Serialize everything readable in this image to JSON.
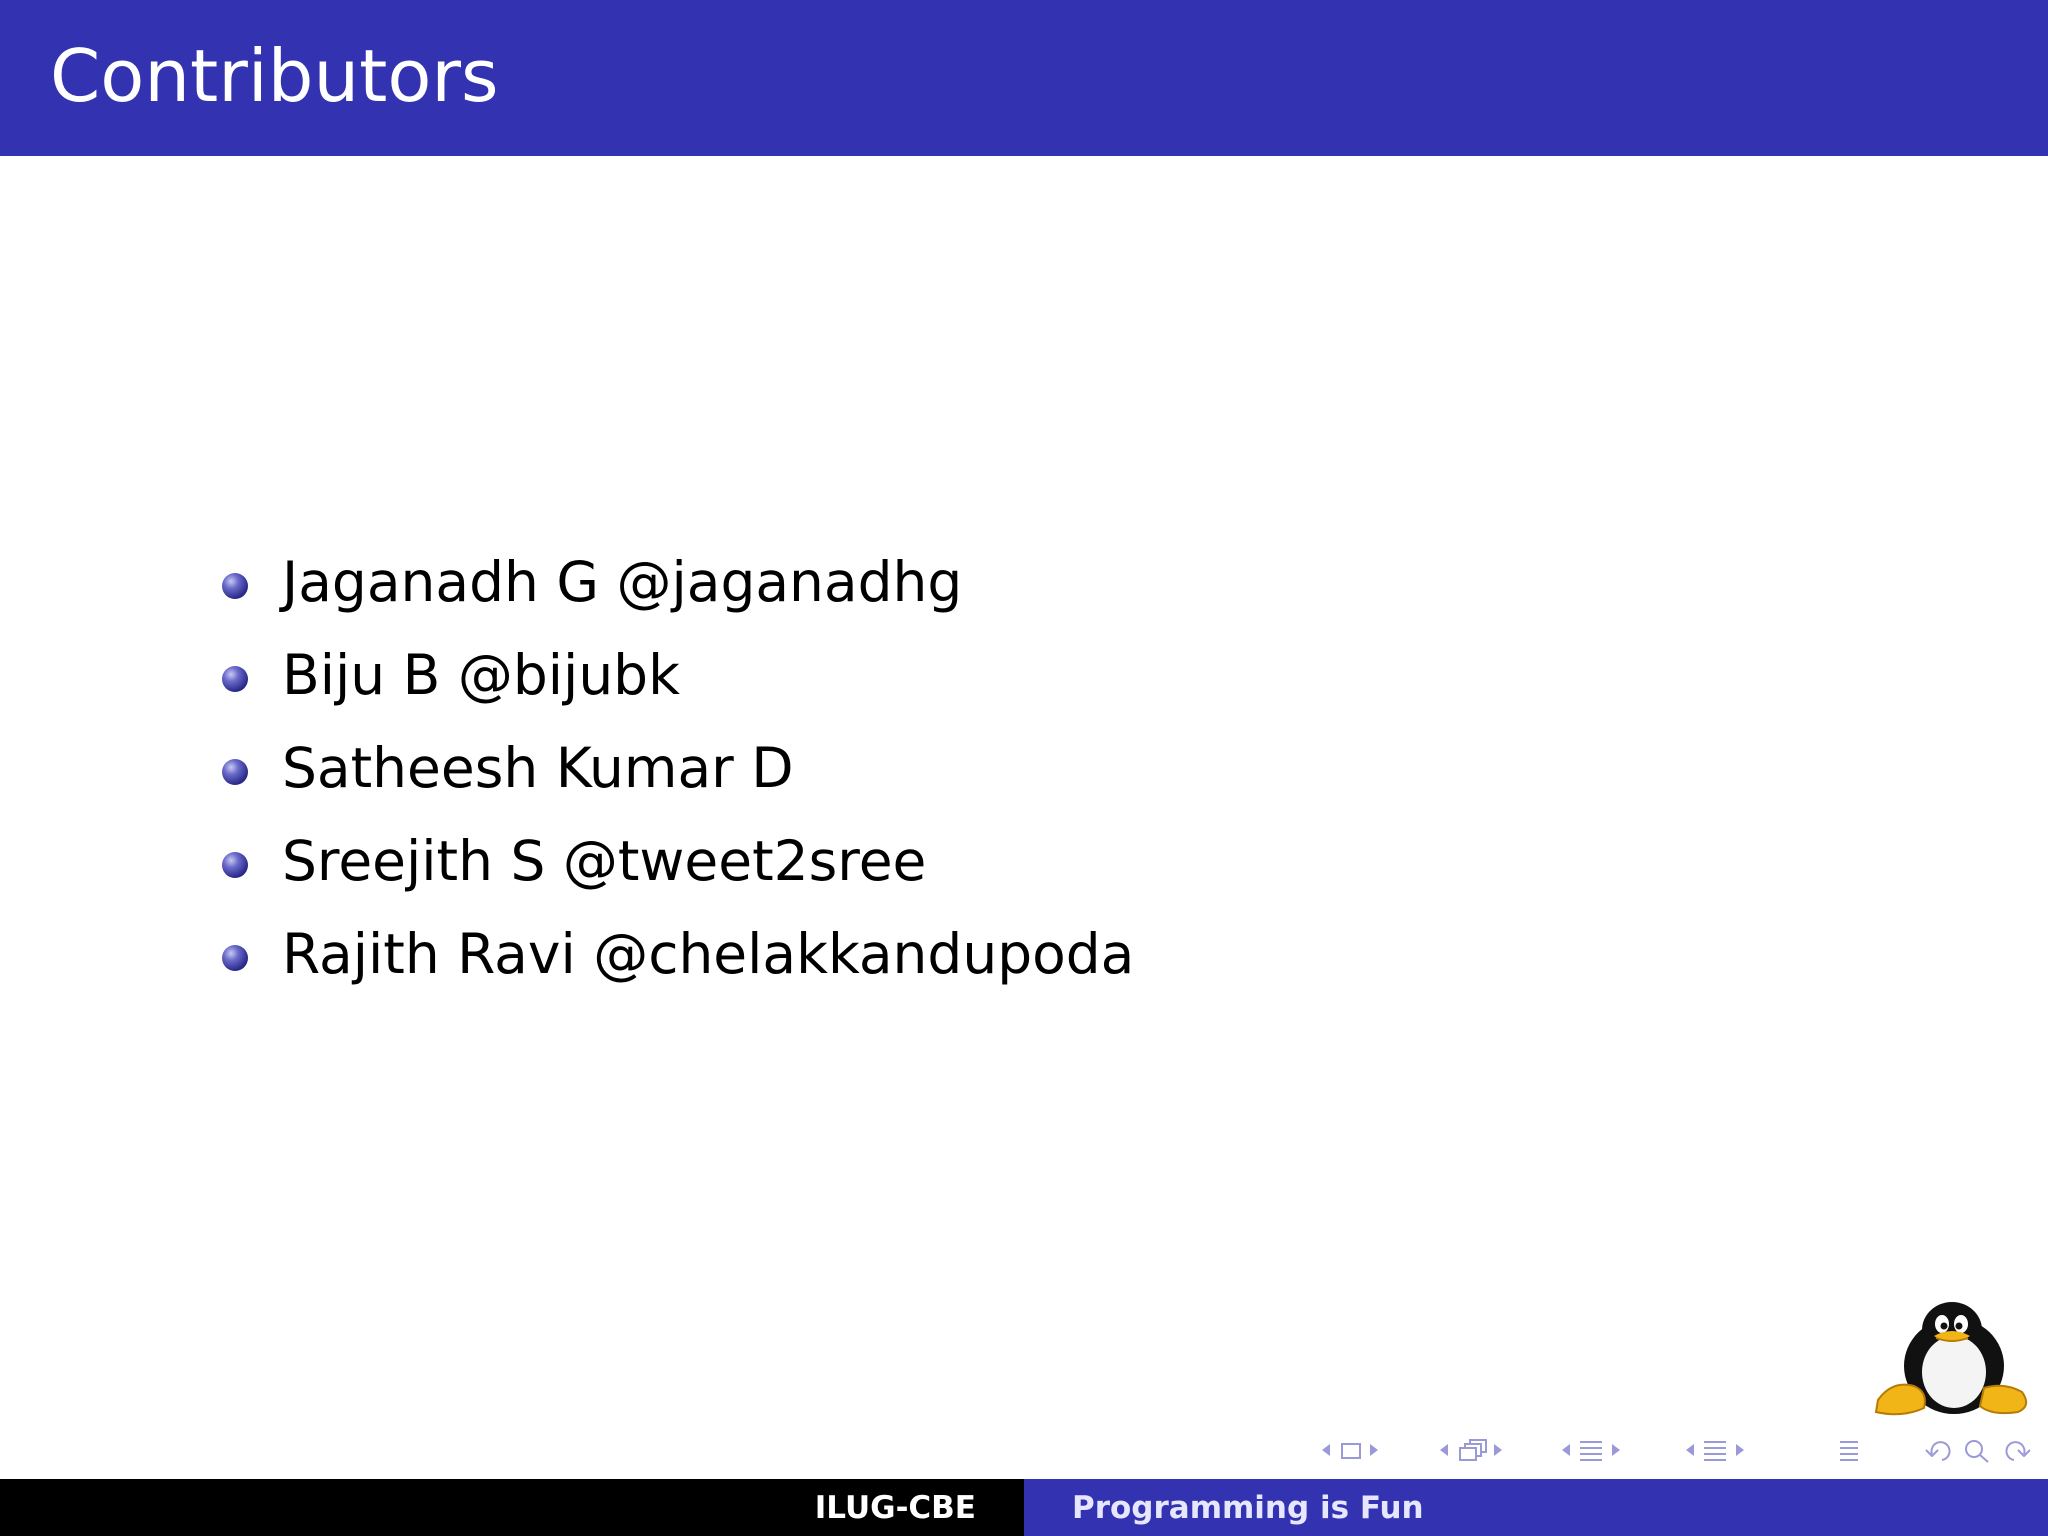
{
  "slide": {
    "title": "Contributors",
    "contributors": [
      "Jaganadh G @jaganadhg",
      "Biju B @bijubk",
      "Satheesh Kumar D",
      "Sreejith S @tweet2sree",
      "Rajith Ravi @chelakkandupoda"
    ]
  },
  "footer": {
    "left": "ILUG-CBE",
    "right": "Programming is Fun"
  },
  "icons": {
    "logo": "tux-penguin-logo",
    "nav": [
      "nav-prev-frame-icon",
      "nav-frame-icon",
      "nav-next-frame-icon",
      "nav-prev-slide-icon",
      "nav-slide-icon",
      "nav-next-slide-icon",
      "nav-prev-subsection-icon",
      "nav-subsection-icon",
      "nav-next-subsection-icon",
      "nav-prev-section-icon",
      "nav-section-icon",
      "nav-next-section-icon",
      "nav-toc-icon",
      "nav-back-icon",
      "nav-search-icon",
      "nav-forward-icon"
    ]
  },
  "colors": {
    "title_bar": "#3333b2",
    "footer_left": "#000000",
    "footer_right": "#3333b2"
  }
}
